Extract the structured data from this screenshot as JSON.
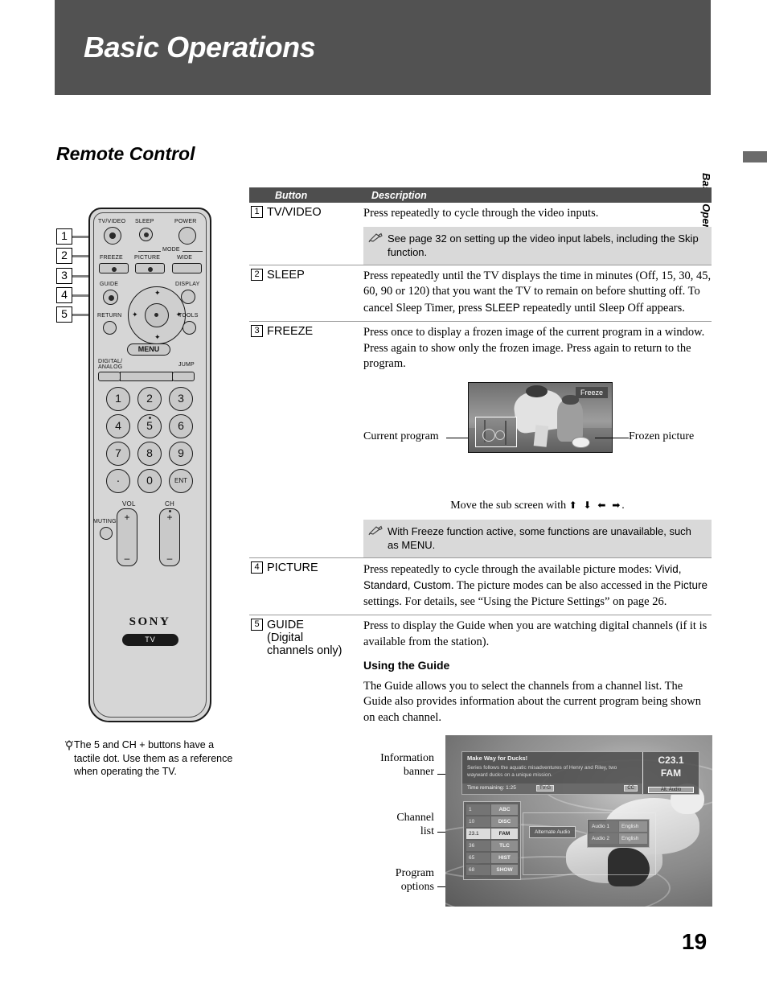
{
  "page": {
    "banner_title": "Basic Operations",
    "section_heading": "Remote Control",
    "edge_tab_label": "Basic Operations",
    "page_number": "19"
  },
  "table": {
    "header": {
      "button": "Button",
      "description": "Description"
    },
    "rows": [
      {
        "num": "1",
        "button": "TV/VIDEO",
        "description": "Press repeatedly to cycle through the video inputs.",
        "note": "See page 32 on setting up the video input labels, including the Skip function."
      },
      {
        "num": "2",
        "button": "SLEEP",
        "description": "Press repeatedly until the TV displays the time in minutes (Off, 15, 30, 45, 60, 90 or 120) that you want the TV to remain on before shutting off. To cancel Sleep Timer, press ",
        "description_sans": "SLEEP",
        "description_tail": " repeatedly until Sleep Off appears."
      },
      {
        "num": "3",
        "button": "FREEZE",
        "description": "Press once to display a frozen image of the current program in a window. Press again to show only the frozen image. Press again to return to the program.",
        "note": "With Freeze function active, some functions are unavailable, such as MENU."
      },
      {
        "num": "4",
        "button": "PICTURE",
        "description_a": "Press repeatedly to cycle through the available picture modes: ",
        "modes": "Vivid, Standard, Custom",
        "description_b": ". The picture modes can be also accessed in the ",
        "picture_word": "Picture",
        "description_c": " settings. For details, see “Using the Picture Settings” on page 26."
      },
      {
        "num": "5",
        "button": "GUIDE",
        "button_sub1": "(Digital",
        "button_sub2": "channels only)",
        "description": "Press to display the Guide when you are watching digital channels (if it is available from the station).",
        "subhead": "Using the Guide",
        "description2": "The Guide allows you to select the channels from a channel list. The Guide also provides information about the current program being shown on each channel."
      }
    ]
  },
  "freeze_figure": {
    "badge": "Freeze",
    "label_left": "Current program",
    "label_right": "Frozen picture",
    "caption": "Move the sub screen with",
    "caption_arrows": "⬆ ⬇ ⬅ ➡",
    "caption_end": "."
  },
  "guide_figure": {
    "labels": {
      "information_banner": "Information\nbanner",
      "channel_list": "Channel\nlist",
      "program_options": "Program\noptions"
    },
    "info_banner": {
      "title": "Make Way for Ducks!",
      "description": "Series follows the aquatic misadventures of Henry and Riley, two wayward ducks on a unique mission.",
      "time_remaining": "Time remaining: 1:25",
      "rating": "TV-G",
      "cc": "CC",
      "channel": "C23.1",
      "network": "FAM",
      "alt_audio": "Alt. Audio"
    },
    "channels": [
      {
        "num": "1",
        "name": "ABC",
        "selected": false
      },
      {
        "num": "10",
        "name": "DISC",
        "selected": false
      },
      {
        "num": "23.1",
        "name": "FAM",
        "selected": true
      },
      {
        "num": "36",
        "name": "TLC",
        "selected": false
      },
      {
        "num": "65",
        "name": "HIST",
        "selected": false
      },
      {
        "num": "68",
        "name": "SHOW",
        "selected": false
      }
    ],
    "alt_audio_button": "Alternate Audio",
    "audio_options": [
      {
        "label": "Audio 1",
        "lang": "English"
      },
      {
        "label": "Audio 2",
        "lang": "English"
      }
    ]
  },
  "remote": {
    "callouts": [
      "1",
      "2",
      "3",
      "4",
      "5"
    ],
    "labels": {
      "tv_video": "TV/VIDEO",
      "sleep": "SLEEP",
      "power": "POWER",
      "mode": "MODE",
      "freeze": "FREEZE",
      "picture": "PICTURE",
      "wide": "WIDE",
      "guide": "GUIDE",
      "display": "DISPLAY",
      "return": "RETURN",
      "tools": "TOOLS",
      "menu": "MENU",
      "digital_analog_1": "DIGITAL/",
      "digital_analog_2": "ANALOG",
      "jump": "JUMP",
      "vol": "VOL",
      "ch": "CH",
      "muting": "MUTING",
      "plus": "+",
      "minus": "–",
      "brand": "SONY",
      "tv_pill": "TV"
    },
    "keypad": [
      "1",
      "2",
      "3",
      "4",
      "5",
      "6",
      "7",
      "8",
      "9",
      "·",
      "0",
      "ENT"
    ],
    "tip": "The 5 and CH + buttons have a tactile dot. Use them as a reference when operating the TV.",
    "tip_icon": " "
  }
}
